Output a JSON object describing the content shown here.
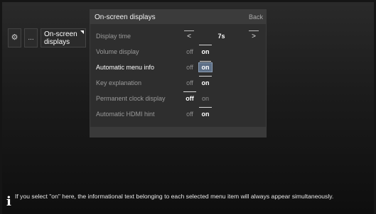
{
  "breadcrumb": {
    "gear_icon": "gear-icon",
    "more_label": "...",
    "active_label": "On-screen displays"
  },
  "panel": {
    "title": "On-screen displays",
    "back_label": "Back"
  },
  "settings": {
    "display_time": {
      "label": "Display time",
      "prev": "<",
      "value": "7s",
      "next": ">"
    },
    "volume_display": {
      "label": "Volume display",
      "off": "off",
      "on": "on",
      "selected": "on"
    },
    "automatic_menu_info": {
      "label": "Automatic menu info",
      "off": "off",
      "on": "on",
      "selected": "on"
    },
    "key_explanation": {
      "label": "Key explanation",
      "off": "off",
      "on": "on",
      "selected": "on"
    },
    "permanent_clock": {
      "label": "Permanent clock display",
      "off": "off",
      "on": "on",
      "selected": "off"
    },
    "hdmi_hint": {
      "label": "Automatic HDMI hint",
      "off": "off",
      "on": "on",
      "selected": "on"
    }
  },
  "info": {
    "icon": "info-icon",
    "text": "If you select \"on\" here, the informational text belonging to each selected menu item will always appear simultaneously."
  },
  "colors": {
    "highlight": "#5d6f86",
    "panel": "#2e2e2e",
    "header": "#3b3b3b"
  }
}
